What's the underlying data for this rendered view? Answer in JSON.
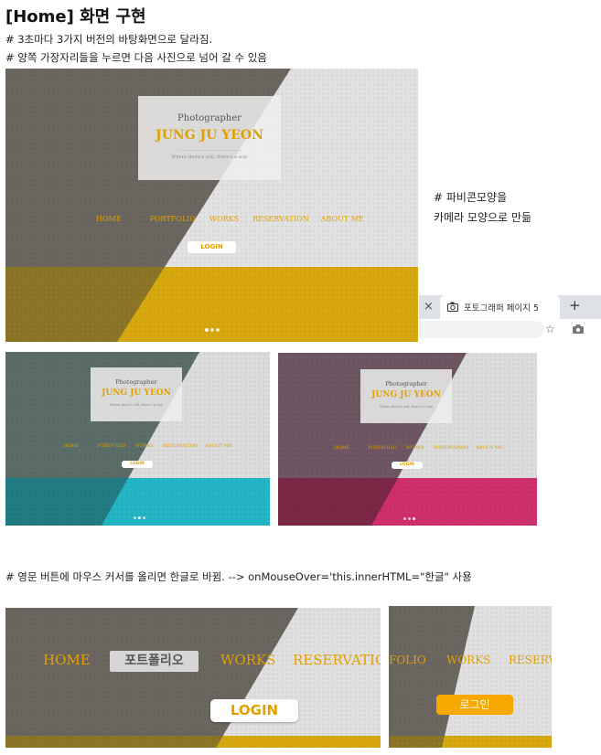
{
  "title": "[Home] 화면 구현",
  "notes": {
    "line1": "# 3초마다 3가지 버전의 바탕화면으로 달라짐.",
    "line2": "# 양쪽 가장자리들을 누르면 다음 사진으로 넘어 갈 수 있음",
    "favicon1": "# 파비콘모양을",
    "favicon2": "카메라 모양으로 만듦",
    "hover": "# 영문 버튼에 마우스 커서를 올리면 한글로 바뀜. --> onMouseOver='this.innerHTML=\"한글\" 사용"
  },
  "site": {
    "photographer": "Photographer",
    "name": "JUNG JU YEON",
    "tagline": "Where there's will, there's a way",
    "nav": [
      "HOME",
      "PORTFOLIO",
      "WORKS",
      "RESERVATION",
      "ABOUT ME"
    ],
    "login": "LOGIN"
  },
  "zoom1": {
    "home": "HOME",
    "portfolio_hover": "포트폴리오",
    "works": "WORKS",
    "reservation": "RESERVATION",
    "login": "LOGIN"
  },
  "zoom2": {
    "folio": "FOLIO",
    "works": "WORKS",
    "reserv": "RESERV",
    "login_hover": "로그인"
  },
  "browser": {
    "close_tab": "×",
    "tab_title": "포토그래퍼 페이지 5",
    "new_tab": "+",
    "star": "☆"
  },
  "colors": {
    "accent": "#e1a000",
    "floor_yellow": "#d6a60e",
    "floor_cyan": "#1fb0be",
    "floor_pink": "#cf2f6c"
  }
}
